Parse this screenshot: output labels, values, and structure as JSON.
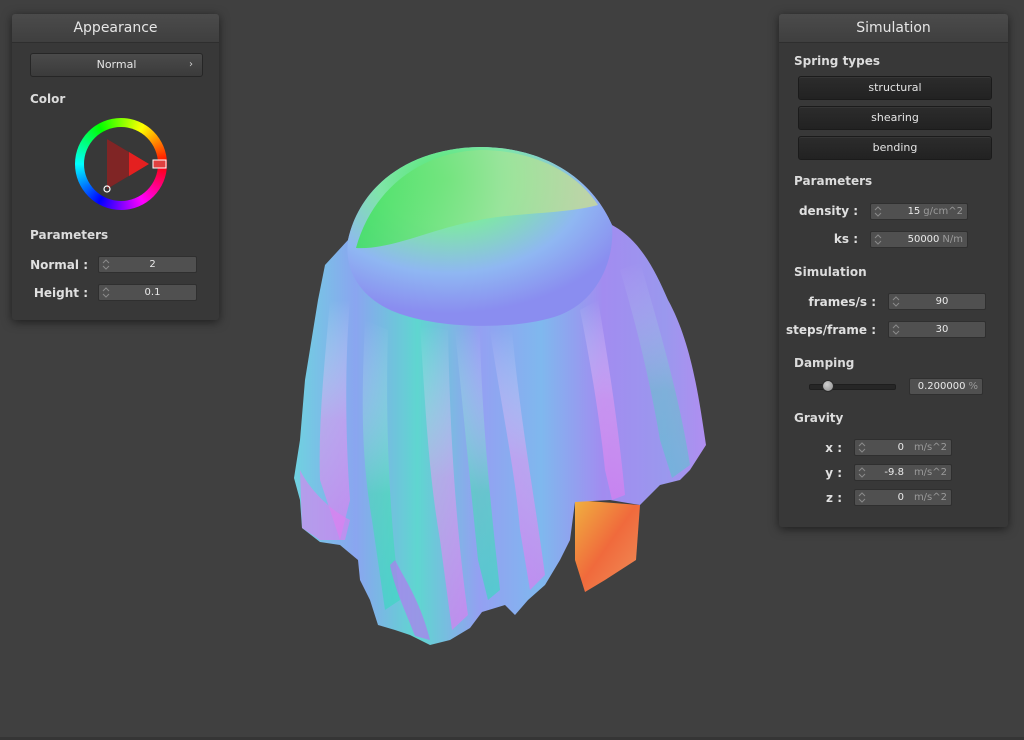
{
  "appearance": {
    "title": "Appearance",
    "shader_dropdown": "Normal",
    "color_label": "Color",
    "parameters_label": "Parameters",
    "normal": {
      "label": "Normal :",
      "value": "2"
    },
    "height": {
      "label": "Height :",
      "value": "0.1"
    }
  },
  "simulation": {
    "title": "Simulation",
    "spring_types_label": "Spring types",
    "spring_buttons": [
      "structural",
      "shearing",
      "bending"
    ],
    "parameters_label": "Parameters",
    "density": {
      "label": "density :",
      "value": "15",
      "unit": "g/cm^2"
    },
    "ks": {
      "label": "ks :",
      "value": "50000",
      "unit": "N/m"
    },
    "simulation_label": "Simulation",
    "frames": {
      "label": "frames/s :",
      "value": "90"
    },
    "steps": {
      "label": "steps/frame :",
      "value": "30"
    },
    "damping_label": "Damping",
    "damping": {
      "value": "0.200000",
      "unit": "%",
      "slider_fraction": 0.2
    },
    "gravity_label": "Gravity",
    "gravity": [
      {
        "label": "x :",
        "value": "0",
        "unit": "m/s^2"
      },
      {
        "label": "y :",
        "value": "-9.8",
        "unit": "m/s^2"
      },
      {
        "label": "z :",
        "value": "0",
        "unit": "m/s^2"
      }
    ]
  },
  "colors": {
    "background": "#404040",
    "panel": "#383838",
    "selected_hue": "#e02020"
  },
  "icons": [
    "chevron-right-icon",
    "spinner-icon",
    "color-wheel",
    "slider-knob"
  ]
}
